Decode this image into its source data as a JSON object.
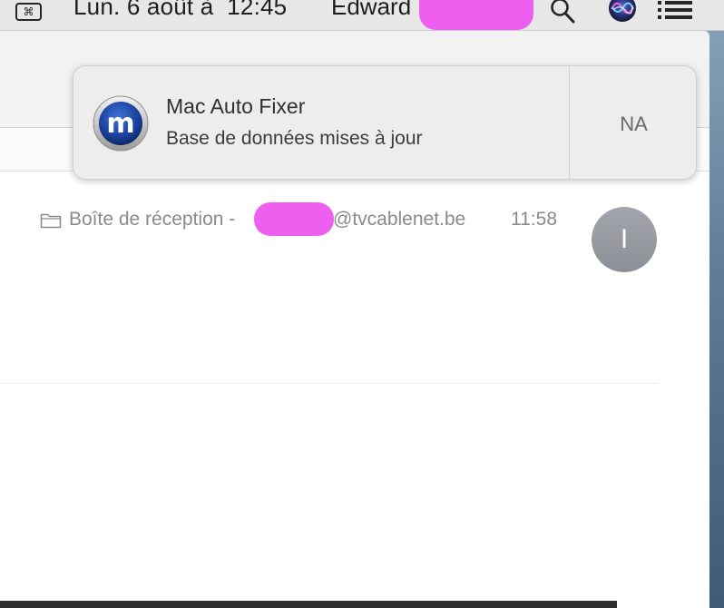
{
  "menubar": {
    "input_menu_glyph": "⌘",
    "clock": "Lun. 6 août à  12:45",
    "user": "Edward",
    "icons": [
      "input-menu-icon",
      "spotlight-search-icon",
      "siri-icon",
      "notification-center-icon"
    ]
  },
  "mail": {
    "mailbox_label": "Boîte de réception -",
    "mailbox_domain": "@tvcablenet.be",
    "time": "11:58",
    "avatar_initial": "I"
  },
  "notification": {
    "app": "Mac Auto Fixer",
    "message": "Base de données mises à jour",
    "action": "NA",
    "app_icon": "mac-auto-fixer-m-logo"
  },
  "colors": {
    "redaction": "#ee5ff0",
    "menubar": "#e7e7e8",
    "avatar": "#9a9ca4",
    "notification_bg": "#ededed"
  }
}
